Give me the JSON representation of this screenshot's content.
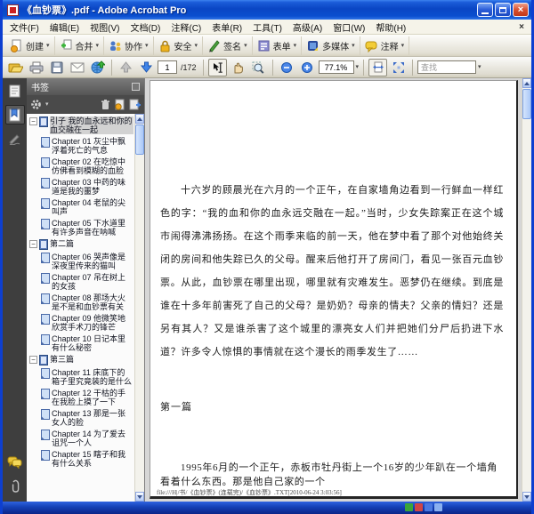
{
  "window": {
    "title": "《血钞票》.pdf - Adobe Acrobat Pro"
  },
  "menu": {
    "items": [
      "文件(F)",
      "编辑(E)",
      "视图(V)",
      "文档(D)",
      "注释(C)",
      "表单(R)",
      "工具(T)",
      "高级(A)",
      "窗口(W)",
      "帮助(H)"
    ]
  },
  "toolbar_primary": {
    "buttons": [
      "创建",
      "合并",
      "协作",
      "安全",
      "签名",
      "表单",
      "多媒体",
      "注释"
    ]
  },
  "toolbar_secondary": {
    "page_number": "1",
    "page_count": "/172",
    "zoom_percent": "77.1%",
    "find_placeholder": "查找"
  },
  "sidebar": {
    "panel_title": "书签",
    "bookmarks": [
      {
        "label": "引子 我的血永远和你的血交融在一起"
      },
      {
        "label": "Chapter 01 灰尘中飘浮着死亡的气息"
      },
      {
        "label": "Chapter 02 在吃惊中仿佛看到模糊的血脸"
      },
      {
        "label": "Chapter 03 中药的味道是我的噩梦"
      },
      {
        "label": "Chapter 04 老鼠的尖叫声"
      },
      {
        "label": "Chapter 05 下水道里有许多声音在呐喊"
      },
      {
        "label": "第二篇"
      },
      {
        "label": "Chapter 06 哭声像是深夜里传来的猫叫"
      },
      {
        "label": "Chapter 07 吊在树上的女孩"
      },
      {
        "label": "Chapter 08 那场大火是不是和血钞票有关"
      },
      {
        "label": "Chapter 09 他微笑地欣赏手术刀的锋芒"
      },
      {
        "label": "Chapter 10 日记本里有什么秘密"
      },
      {
        "label": "第三篇"
      },
      {
        "label": "Chapter 11 床底下的箱子里究竟装的是什么"
      },
      {
        "label": "Chapter 12 干枯的手在我脸上摸了一下"
      },
      {
        "label": "Chapter 13 那是一张女人的脸"
      },
      {
        "label": "Chapter 14 为了爱去诅咒一个人"
      },
      {
        "label": "Chapter 15 瞎子和我有什么关系"
      }
    ]
  },
  "document": {
    "paragraph": "十六岁的顾晨光在六月的一个正午，在自家墙角边看到一行鲜血一样红色的字：“我的血和你的血永远交融在一起。”当时，少女失踪案正在这个城市闹得沸沸扬扬。在这个雨季来临的前一天，他在梦中看了那个对他始终关闭的房间和他失踪已久的父母。醒来后他打开了房间门，看见一张百元血钞票。从此，血钞票在哪里出现，哪里就有灾难发生。恶梦仍在继续。到底是谁在十多年前害死了自己的父母？是奶奶？母亲的情夫？父亲的情妇？还是另有其人？又是谁杀害了这个城里的漂亮女人们并把她们分尸后扔进下水道？许多令人惊惧的事情就在这个漫长的雨季发生了……",
    "section_heading": "第一篇",
    "opening_line": "1995年6月的一个正午，赤板市牡丹街上一个16岁的少年趴在一个墙角看着什么东西。那是他自己家的一个",
    "source_footer": "file:///H|/书/《血钞票》(连载完)/《血钞票》.TXT[2010-06-24 3:03:56]"
  },
  "icons": {
    "caret_down": "▾",
    "collapse_box": "−",
    "close_glyph": "×"
  },
  "colors": {
    "titlebar_blue": "#0a4ecf",
    "panel_dark": "#4a4a4a",
    "selection_gray": "#d2d2d2",
    "page_white": "#ffffff"
  }
}
